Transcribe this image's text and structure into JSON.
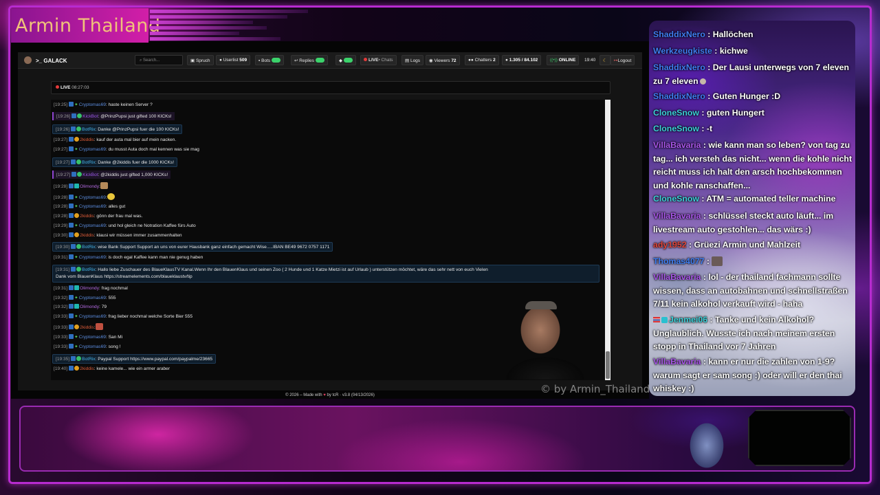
{
  "stream": {
    "title": "Armin Thailand",
    "watermark": "© by Armin_Thailand"
  },
  "dashboard": {
    "brand": ">_ GALACK",
    "search": {
      "placeholder": "Search..."
    },
    "nav": {
      "spruch": "Spruch",
      "userlist": "Userlist",
      "userlist_count": "509",
      "bots": "Bots",
      "replies": "Replies",
      "live_chats": "LIVE",
      "live_chats_sub": "• Chats",
      "logs": "Logs",
      "viewers": "Viewers",
      "viewers_count": "72",
      "chatters": "Chatters",
      "chatters_count": "2",
      "messages": "1.305 / 84.102",
      "online": "ONLINE",
      "time": "19:40",
      "logout": "Logout"
    },
    "live": {
      "label": "LIVE",
      "duration": "08:27:03"
    },
    "footer": {
      "text": "© 2026 – Made with ",
      "by": " by tcR",
      "version": " · v3.8 (04/13/2026)"
    }
  },
  "chat_log": [
    {
      "time": "[19:25]",
      "user": "Cryptomas69",
      "text": ": haste keinen Server ?",
      "type": "c"
    },
    {
      "time": "[19:26]",
      "user": "KickBot",
      "text": ": @PrinzPupsi just gifted 100 KICKs!",
      "type": "k"
    },
    {
      "time": "[19:26]",
      "user": "BotRix",
      "text": ": Danke @PrinzPupsi fuer die 100 KICKs!",
      "type": "bot"
    },
    {
      "time": "[19:27]",
      "user": "2kiddis",
      "text": ": kauf der auta mal bier auf mein nacken.",
      "type": "2k"
    },
    {
      "time": "[19:27]",
      "user": "Cryptomas69",
      "text": ": du musst Auta doch mal kennen was sie mag",
      "type": "c"
    },
    {
      "time": "[19:27]",
      "user": "BotRix",
      "text": ": Danke @2kiddis fuer die 1000 KICKs!",
      "type": "bot"
    },
    {
      "time": "[19:27]",
      "user": "KickBot",
      "text": ": @2kiddis just gifted 1,000 KICKs!",
      "type": "k"
    },
    {
      "time": "[19:28]",
      "user": "Olimondy",
      "text": ":",
      "type": "cl"
    },
    {
      "time": "[19:28]",
      "user": "Cryptomas69",
      "text": ":",
      "type": "c"
    },
    {
      "time": "[19:28]",
      "user": "Cryptomas69",
      "text": ": alles gut",
      "type": "c"
    },
    {
      "time": "[19:28]",
      "user": "2kiddis",
      "text": ": gönn der frau mal was.",
      "type": "2k"
    },
    {
      "time": "[19:29]",
      "user": "Cryptomas69",
      "text": ": und hol gleich ne Notration Kaffee fürs Auto",
      "type": "c"
    },
    {
      "time": "[19:30]",
      "user": "2kiddis",
      "text": ": klausi wir müssen immer zusammenhalten",
      "type": "2k"
    },
    {
      "time": "[19:30]",
      "user": "BotRix",
      "text": ": wise Bank Support Support an uns von eurer Hausbank ganz einfach gemacht Wise.....IBAN BE49 9672 0757 1171",
      "type": "bot"
    },
    {
      "time": "[19:31]",
      "user": "Cryptomas69",
      "text": ": is doch egal Kaffee kann man nie genug haben",
      "type": "c"
    },
    {
      "time": "[19:31]",
      "user": "BotRix",
      "text": ": Hallo liebe Zuschauer des BlaueKlausTV Kanal.Wenn Ihr den BlauenKlaus und seinen Zoo ( 2 Hunde und 1 Katze Mietzi ist auf Urlaub ) unterstützen möchtet, wäre das sehr nett von euch Vielen",
      "text2": "Dank vom BlauenKlaus https://streamelements.com/blaueklaustv/tip",
      "type": "bot"
    },
    {
      "time": "[19:31]",
      "user": "Olimondy",
      "text": ": frag nochmal",
      "type": "cl"
    },
    {
      "time": "[19:32]",
      "user": "Cryptomas69",
      "text": ": 555",
      "type": "c"
    },
    {
      "time": "[19:32]",
      "user": "Olimondy",
      "text": ": 79",
      "type": "cl"
    },
    {
      "time": "[19:33]",
      "user": "Cryptomas69",
      "text": ": frag lieber nochmal welche Sorte Bier 555",
      "type": "c"
    },
    {
      "time": "[19:33]",
      "user": "2kiddis",
      "text": ":",
      "type": "2k"
    },
    {
      "time": "[19:33]",
      "user": "Cryptomas69",
      "text": ": San Mi",
      "type": "c"
    },
    {
      "time": "[19:33]",
      "user": "Cryptomas69",
      "text": ": song !",
      "type": "c"
    },
    {
      "time": "[19:35]",
      "user": "BotRix",
      "text": ": Paypal Support https://www.paypal.com/paypalme/23665",
      "type": "bot"
    },
    {
      "time": "[19:40]",
      "user": "2kiddis",
      "text": ": keine kamele... wie ein armer araber",
      "type": "2k"
    }
  ],
  "overlay_chat": [
    {
      "user": "ShaddixNero",
      "text": " : Hallöchen",
      "color": "blue"
    },
    {
      "user": "Werkzeugkiste",
      "text": " : kichwe",
      "color": "blue"
    },
    {
      "user": "ShaddixNero",
      "text": " : Der Lausi unterwegs von 7 eleven zu 7 eleven",
      "color": "blue"
    },
    {
      "user": "ShaddixNero",
      "text": " : Guten Hunger :D",
      "color": "blue"
    },
    {
      "user": "CloneSnow",
      "text": " : guten Hungert",
      "color": "cyan"
    },
    {
      "user": "CloneSnow",
      "text": " : -t",
      "color": "cyan"
    },
    {
      "user": "VillaBavaria",
      "text": " : wie kann man so leben? von tag zu tag... ich versteh das nicht... wenn die kohle nicht reicht muss ich halt den arsch hochbekommen und kohle ranschaffen...",
      "color": "purple"
    },
    {
      "user": "CloneSnow",
      "text": " : ATM = automated teller machine",
      "color": "cyan"
    },
    {
      "user": "VillaBavaria",
      "text": " : schlüssel steckt auto läuft... im livestream auto gestohlen... das wärs :)",
      "color": "purple"
    },
    {
      "user": "ady1952",
      "text": " : Grüezi Armin und Mahlzeit",
      "color": "red"
    },
    {
      "user": "Thomas4077",
      "text": " : ",
      "color": "blue"
    },
    {
      "user": "VillaBavaria",
      "text": " : lol - der thailand fachmann sollte wissen, dass an autobahnen und schnellstraßen 7/11 kein alkohol verkauft wird - haha",
      "color": "purple"
    },
    {
      "user": "Jenmei06",
      "text": " : Tanke und kein Alkohol? Unglaublich. Wusste ich nach meinem ersten stopp in Thailand vor 7 Jahren",
      "color": "cyan"
    },
    {
      "user": "VillaBavaria",
      "text": " : kann er nur die zahlen von 1-9? warum sagt er sam song :) oder will er den thai whiskey :)",
      "color": "purple"
    }
  ]
}
